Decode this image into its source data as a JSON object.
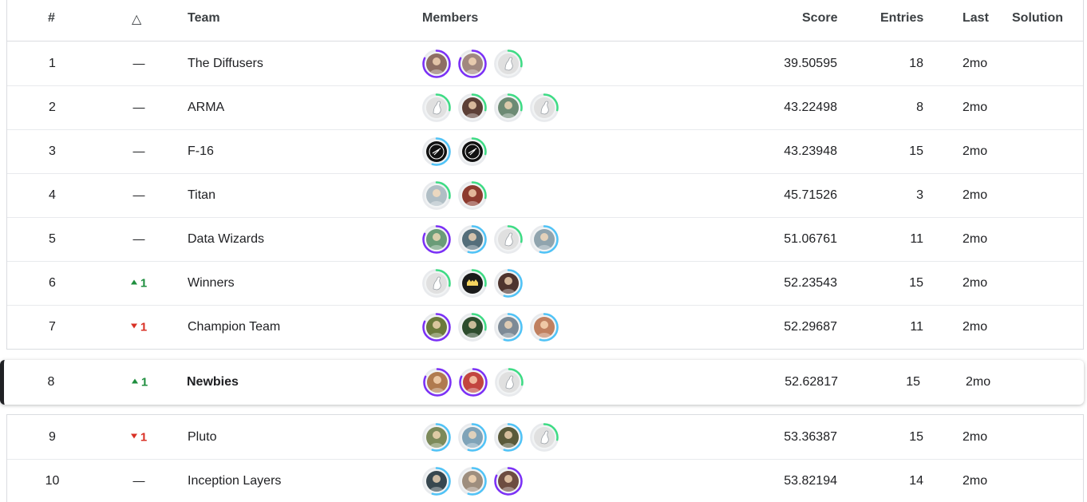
{
  "columns": {
    "rank": "#",
    "delta": "△",
    "team": "Team",
    "members": "Members",
    "score": "Score",
    "entries": "Entries",
    "last": "Last",
    "solution": "Solution"
  },
  "colors": {
    "green": "#1e8e3e",
    "red": "#d93025",
    "ring_purple": "#7b2ff7",
    "ring_blue": "#4fc3f7",
    "ring_green": "#3ddc84"
  },
  "rows_top": [
    {
      "rank": "1",
      "delta": "—",
      "dir": "none",
      "team": "The Diffusers",
      "score": "39.50595",
      "entries": "18",
      "last": "2mo",
      "members": [
        {
          "icon": "user-photo-icon",
          "ring": "purple",
          "face": "#8d6e63"
        },
        {
          "icon": "user-photo-icon",
          "ring": "purple",
          "face": "#a1887f"
        },
        {
          "icon": "default-goose-avatar-icon",
          "ring": "green",
          "face": "#e0e0e0"
        }
      ]
    },
    {
      "rank": "2",
      "delta": "—",
      "dir": "none",
      "team": "ARMA",
      "score": "43.22498",
      "entries": "8",
      "last": "2mo",
      "members": [
        {
          "icon": "default-goose-avatar-icon",
          "ring": "green",
          "face": "#e0e0e0"
        },
        {
          "icon": "user-photo-icon",
          "ring": "green",
          "face": "#5d4037"
        },
        {
          "icon": "user-photo-icon",
          "ring": "green",
          "face": "#6d8b74"
        },
        {
          "icon": "default-goose-avatar-icon",
          "ring": "green",
          "face": "#e0e0e0"
        }
      ]
    },
    {
      "rank": "3",
      "delta": "—",
      "dir": "none",
      "team": "F-16",
      "score": "43.23948",
      "entries": "15",
      "last": "2mo",
      "members": [
        {
          "icon": "f16-logo-avatar-icon",
          "ring": "blue",
          "face": "#111111"
        },
        {
          "icon": "f16-logo-avatar-icon",
          "ring": "green",
          "face": "#111111"
        }
      ]
    },
    {
      "rank": "4",
      "delta": "—",
      "dir": "none",
      "team": "Titan",
      "score": "45.71526",
      "entries": "3",
      "last": "2mo",
      "members": [
        {
          "icon": "user-photo-icon",
          "ring": "green",
          "face": "#b0bec5"
        },
        {
          "icon": "user-photo-icon",
          "ring": "green",
          "face": "#8d3b2f"
        }
      ]
    },
    {
      "rank": "5",
      "delta": "—",
      "dir": "none",
      "team": "Data Wizards",
      "score": "51.06761",
      "entries": "11",
      "last": "2mo",
      "members": [
        {
          "icon": "user-photo-icon",
          "ring": "purple",
          "face": "#6a9c78"
        },
        {
          "icon": "user-photo-icon",
          "ring": "blue",
          "face": "#546e7a"
        },
        {
          "icon": "default-goose-avatar-icon",
          "ring": "green",
          "face": "#e0e0e0"
        },
        {
          "icon": "user-photo-icon",
          "ring": "blue",
          "face": "#90a4ae"
        }
      ]
    },
    {
      "rank": "6",
      "delta": "1",
      "dir": "up",
      "team": "Winners",
      "score": "52.23543",
      "entries": "15",
      "last": "2mo",
      "members": [
        {
          "icon": "default-goose-avatar-icon",
          "ring": "green",
          "face": "#e0e0e0"
        },
        {
          "icon": "batman-avatar-icon",
          "ring": "green",
          "face": "#1a1a1a"
        },
        {
          "icon": "user-photo-icon",
          "ring": "blue",
          "face": "#4e342e"
        }
      ]
    },
    {
      "rank": "7",
      "delta": "1",
      "dir": "down",
      "team": "Champion Team",
      "score": "52.29687",
      "entries": "11",
      "last": "2mo",
      "members": [
        {
          "icon": "user-photo-icon",
          "ring": "purple",
          "face": "#6b7a3c"
        },
        {
          "icon": "user-photo-icon",
          "ring": "green",
          "face": "#2e4d2e"
        },
        {
          "icon": "user-photo-icon",
          "ring": "blue",
          "face": "#7d8a96"
        },
        {
          "icon": "user-photo-icon",
          "ring": "blue",
          "face": "#c08060"
        }
      ]
    }
  ],
  "own_row": {
    "rank": "8",
    "delta": "1",
    "dir": "up",
    "team": "Newbies",
    "score": "52.62817",
    "entries": "15",
    "last": "2mo",
    "members": [
      {
        "icon": "user-photo-icon",
        "ring": "purple",
        "face": "#b07a4f"
      },
      {
        "icon": "user-photo-icon",
        "ring": "purple",
        "face": "#c2453f"
      },
      {
        "icon": "default-goose-avatar-icon",
        "ring": "green",
        "face": "#e0e0e0"
      }
    ]
  },
  "rows_bottom": [
    {
      "rank": "9",
      "delta": "1",
      "dir": "down",
      "team": "Pluto",
      "score": "53.36387",
      "entries": "15",
      "last": "2mo",
      "members": [
        {
          "icon": "user-photo-icon",
          "ring": "blue",
          "face": "#7c8a5a"
        },
        {
          "icon": "user-photo-icon",
          "ring": "blue",
          "face": "#7fa3b8"
        },
        {
          "icon": "user-photo-icon",
          "ring": "blue",
          "face": "#5a5a3a"
        },
        {
          "icon": "default-goose-avatar-icon",
          "ring": "green",
          "face": "#e0e0e0"
        }
      ]
    },
    {
      "rank": "10",
      "delta": "—",
      "dir": "none",
      "team": "Inception Layers",
      "score": "53.82194",
      "entries": "14",
      "last": "2mo",
      "members": [
        {
          "icon": "user-photo-icon",
          "ring": "blue",
          "face": "#37474f"
        },
        {
          "icon": "user-photo-icon",
          "ring": "blue",
          "face": "#9e8e7e"
        },
        {
          "icon": "user-photo-icon",
          "ring": "purple",
          "face": "#6d4c41"
        }
      ]
    }
  ]
}
